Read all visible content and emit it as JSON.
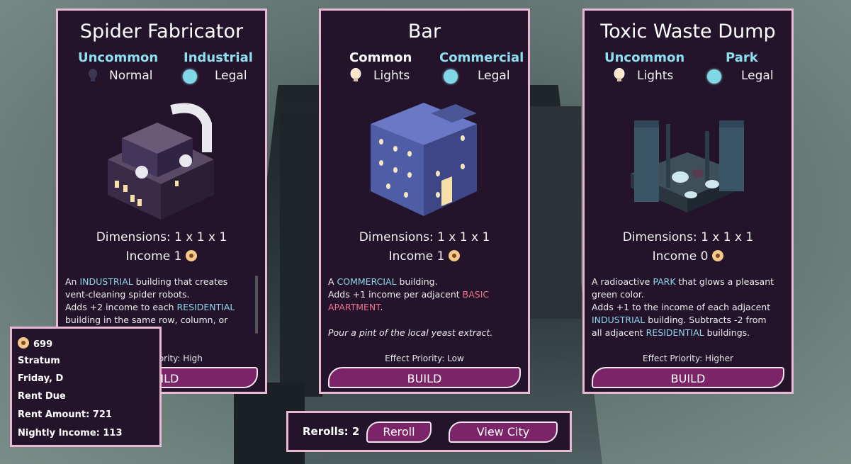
{
  "cards": [
    {
      "title": "Spider Fabricator",
      "rarity": "Uncommon",
      "category": "Industrial",
      "light": "Normal",
      "legality": "Legal",
      "dimensions": "Dimensions: 1 x 1 x 1",
      "income": "Income 1",
      "desc": {
        "p1": "An ",
        "h1": "INDUSTRIAL",
        "p2": " building that creates vent-cleaning spider robots.",
        "p3": "Adds +2 income to each ",
        "h2": "RESIDENTIAL",
        "p4": " building in the same row, column, or stack."
      },
      "priority": "Effect Priority: High",
      "build": "BUILD"
    },
    {
      "title": "Bar",
      "rarity": "Common",
      "category": "Commercial",
      "light": "Lights",
      "legality": "Legal",
      "dimensions": "Dimensions: 1 x 1 x 1",
      "income": "Income 1",
      "desc": {
        "p1": "A ",
        "h1": "COMMERCIAL",
        "p2": " building.",
        "p3": "Adds +1 income per adjacent ",
        "h2": "BASIC APARTMENT",
        "p4": ".",
        "flavor": "Pour a pint of the local yeast extract."
      },
      "priority": "Effect Priority: Low",
      "build": "BUILD"
    },
    {
      "title": "Toxic Waste Dump",
      "rarity": "Uncommon",
      "category": "Park",
      "light": "Lights",
      "legality": "Legal",
      "dimensions": "Dimensions: 1 x 1 x 1",
      "income": "Income 0",
      "desc": {
        "p1": "A radioactive ",
        "h1": "PARK",
        "p2": " that glows a pleasant green color.",
        "p3": "Adds +1 to the income of each adjacent ",
        "h2": "INDUSTRIAL",
        "p4": " building. Subtracts -2 from all adjacent ",
        "h3": "RESIDENTIAL",
        "p5": " buildings."
      },
      "priority": "Effect Priority: Higher",
      "build": "BUILD"
    }
  ],
  "stats": {
    "coins": "699",
    "stratum": "Stratum",
    "day": "Friday, D",
    "rent_due": "Rent Due",
    "rent_amount": "Rent Amount: 721",
    "nightly_income": "Nightly Income: 113"
  },
  "rerolls": {
    "label": "Rerolls: 2",
    "reroll_button": "Reroll",
    "view_city_button": "View City"
  },
  "colors": {
    "card_bg": "#23142b",
    "card_border": "#e9b8d4",
    "button": "#7b2468",
    "highlight": "#8fd6e8",
    "apartment": "#ef6f8e"
  }
}
